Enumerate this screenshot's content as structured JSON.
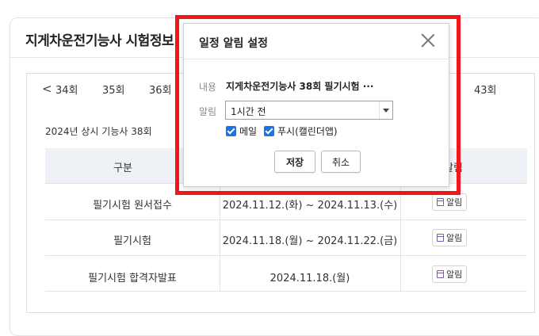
{
  "card": {
    "title": "지게차운전기능사 시험정보"
  },
  "rounds": {
    "prev_arrow": "<",
    "items": [
      "34회",
      "35회",
      "36회"
    ],
    "last": "43회"
  },
  "section": {
    "year_label": "2024년 상시 기능사 38회"
  },
  "table": {
    "headers": {
      "category": "구분",
      "alarm": "알림"
    },
    "rows": [
      {
        "name": "필기시험 원서접수",
        "period": "2024.11.12.(화) ~ 2024.11.13.(수)",
        "alarm": "알림"
      },
      {
        "name": "필기시험",
        "period": "2024.11.18.(월) ~ 2024.11.22.(금)",
        "alarm": "알림"
      },
      {
        "name": "필기시험 합격자발표",
        "period": "2024.11.18.(월)",
        "alarm": "알림"
      }
    ]
  },
  "modal": {
    "title": "일정 알림 설정",
    "content_label": "내용",
    "content_value": "지게차운전기능사 38회 필기시험 ···",
    "alarm_label": "알림",
    "alarm_select_value": "1시간 전",
    "options": {
      "email": "메일",
      "push": "푸시(캘린더앱)"
    },
    "save_label": "저장",
    "cancel_label": "취소"
  },
  "colors": {
    "highlight_border": "#f2161b",
    "checkbox": "#1a73e8",
    "table_header_bg": "#eef1f5"
  }
}
